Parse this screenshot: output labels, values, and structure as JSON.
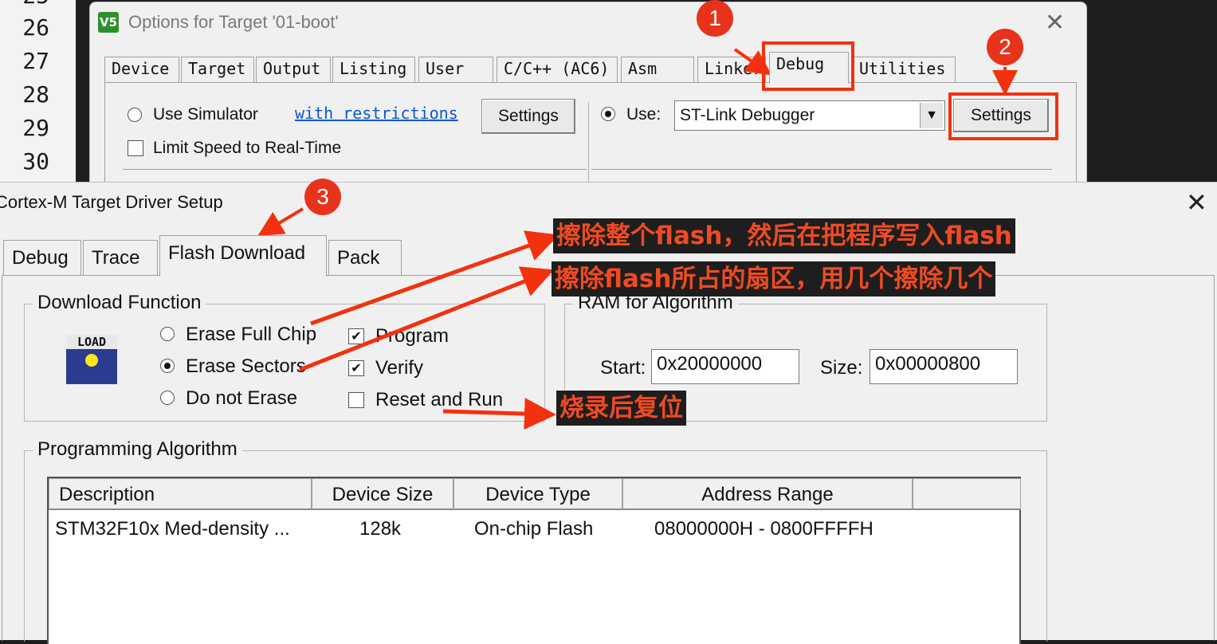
{
  "editor": {
    "line_numbers": [
      "26",
      "27",
      "28",
      "29",
      "30"
    ]
  },
  "options_window": {
    "title": "Options for Target '01-boot'",
    "logo_text": "V5",
    "tabs": [
      "Device",
      "Target",
      "Output",
      "Listing",
      "User",
      "C/C++ (AC6)",
      "Asm",
      "Linker",
      "Debug",
      "Utilities"
    ],
    "active_tab": "Debug",
    "use_simulator_label": "Use Simulator",
    "with_restrictions_link": "with restrictions",
    "settings_left_label": "Settings",
    "limit_speed_label": "Limit Speed to Real-Time",
    "use_label": "Use:",
    "debugger_value": "ST-Link Debugger",
    "settings_right_label": "Settings"
  },
  "cortex_window": {
    "title": "Cortex-M Target Driver Setup",
    "tabs": [
      "Debug",
      "Trace",
      "Flash Download",
      "Pack"
    ],
    "active_tab": "Flash Download",
    "download_function": {
      "group_label": "Download Function",
      "load_icon_text": "LOAD",
      "erase_full_chip": "Erase Full Chip",
      "erase_sectors": "Erase Sectors",
      "do_not_erase": "Do not Erase",
      "selected_erase": "Erase Sectors",
      "program": "Program",
      "verify": "Verify",
      "reset_and_run": "Reset and Run",
      "program_checked": true,
      "verify_checked": true,
      "reset_and_run_checked": false
    },
    "ram_for_algorithm": {
      "group_label": "RAM for Algorithm",
      "start_label": "Start:",
      "start_value": "0x20000000",
      "size_label": "Size:",
      "size_value": "0x00000800"
    },
    "programming_algorithm": {
      "group_label": "Programming Algorithm",
      "columns": [
        "Description",
        "Device Size",
        "Device Type",
        "Address Range"
      ],
      "rows": [
        [
          "STM32F10x Med-density ...",
          "128k",
          "On-chip Flash",
          "08000000H - 0800FFFFH"
        ]
      ]
    }
  },
  "annotations": {
    "badges": [
      "1",
      "2",
      "3"
    ],
    "note_erase_full": "擦除整个flash，然后在把程序写入flash",
    "note_erase_sectors": "擦除flash所占的扇区，用几个擦除几个",
    "note_reset": "烧录后复位",
    "color": "#f2320e"
  }
}
